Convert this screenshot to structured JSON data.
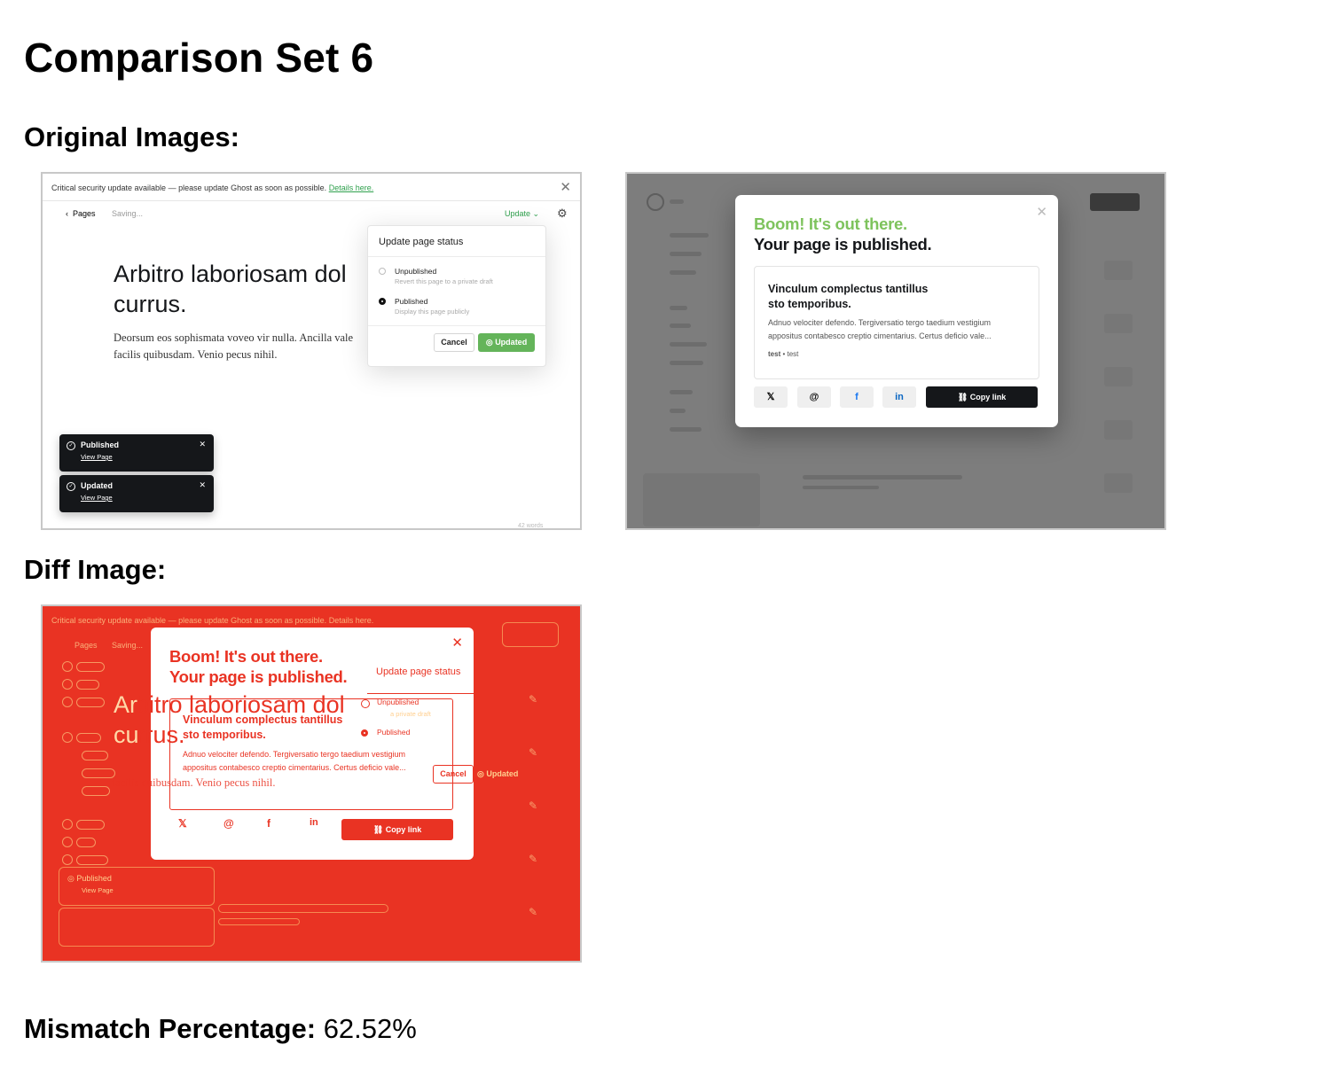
{
  "page": {
    "title": "Comparison Set 6",
    "original_heading": "Original Images:",
    "diff_heading": "Diff Image:",
    "mismatch_label": "Mismatch Percentage:",
    "mismatch_value": "62.52%"
  },
  "image1": {
    "banner_text": "Critical security update available — please update Ghost as soon as possible.",
    "banner_link": "Details here.",
    "back_label": "Pages",
    "saving": "Saving...",
    "update_menu": "Update",
    "heading_line1": "Arbitro laboriosam dol",
    "heading_line2": "currus.",
    "body_line1": "Deorsum eos sophismata voveo vir nulla. Ancilla vale",
    "body_line2": "facilis quibusdam. Venio pecus nihil.",
    "popover": {
      "title": "Update page status",
      "option1_label": "Unpublished",
      "option1_desc": "Revert this page to a private draft",
      "option2_label": "Published",
      "option2_desc": "Display this page publicly",
      "cancel": "Cancel",
      "confirm": "Updated"
    },
    "toasts": [
      {
        "title": "Published",
        "link": "View Page"
      },
      {
        "title": "Updated",
        "link": "View Page"
      }
    ],
    "word_count": "42 words"
  },
  "image2": {
    "headline": "Boom! It's out there.",
    "subheadline": "Your page is published.",
    "card_title_line1": "Vinculum complectus tantillus",
    "card_title_line2": "sto temporibus.",
    "card_excerpt_line1": "Adnuo velociter defendo. Tergiversatio tergo taedium vestigium",
    "card_excerpt_line2": "appositus contabesco creptio cimentarius. Certus deficio vale...",
    "card_author": "test",
    "card_tag": "test",
    "copy_link": "Copy link",
    "share_icons": [
      "x-icon",
      "threads-icon",
      "facebook-icon",
      "linkedin-icon"
    ]
  },
  "colors": {
    "ghost_green": "#30a14e",
    "boom_green": "#7ec35d",
    "diff_red": "#e93323"
  }
}
